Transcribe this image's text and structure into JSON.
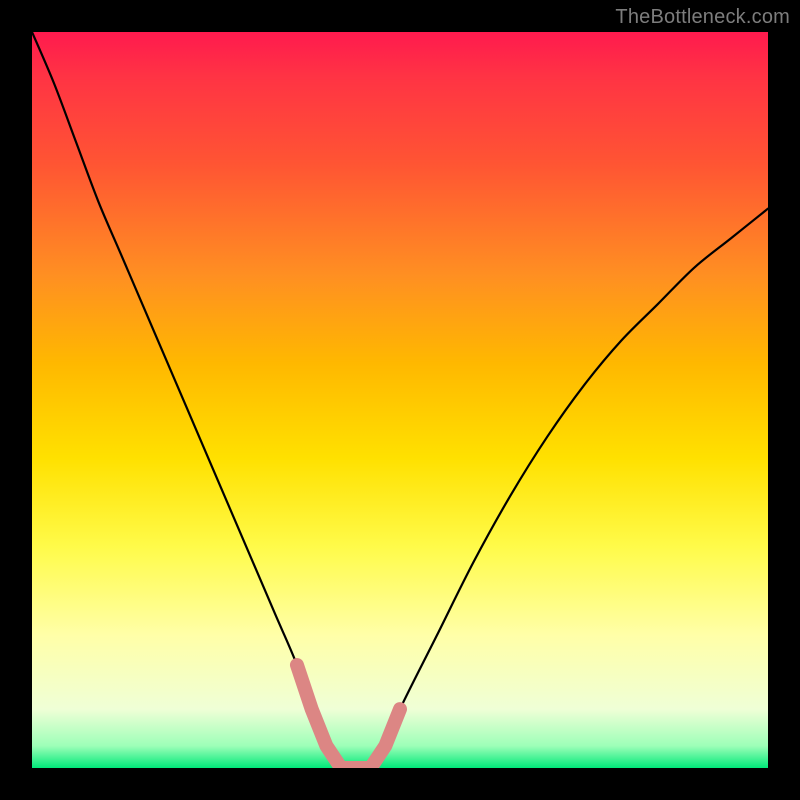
{
  "watermark": {
    "text": "TheBottleneck.com"
  },
  "colors": {
    "background": "#000000",
    "curve": "#000000",
    "marker": "#dc8684",
    "gradient_stops": [
      "#ff1a4e",
      "#ff3344",
      "#ff5533",
      "#ff8f22",
      "#ffb800",
      "#ffe100",
      "#fffb4a",
      "#ffffa8",
      "#efffd6",
      "#9dffb8",
      "#00e879"
    ]
  },
  "chart_data": {
    "type": "line",
    "title": "",
    "xlabel": "",
    "ylabel": "",
    "xlim": [
      0,
      100
    ],
    "ylim": [
      0,
      100
    ],
    "grid": false,
    "legend_position": "none",
    "series": [
      {
        "name": "bottleneck-curve",
        "x": [
          0,
          3,
          6,
          9,
          12,
          15,
          18,
          21,
          24,
          27,
          30,
          33,
          36,
          38,
          40,
          42,
          44,
          46,
          48,
          50,
          55,
          60,
          65,
          70,
          75,
          80,
          85,
          90,
          95,
          100
        ],
        "values": [
          100,
          93,
          85,
          77,
          70,
          63,
          56,
          49,
          42,
          35,
          28,
          21,
          14,
          8,
          3,
          0,
          0,
          0,
          3,
          8,
          18,
          28,
          37,
          45,
          52,
          58,
          63,
          68,
          72,
          76
        ]
      }
    ],
    "markers": {
      "name": "highlight-segment",
      "x": [
        36,
        38,
        40,
        42,
        44,
        46,
        48,
        50
      ],
      "values": [
        14,
        8,
        3,
        0,
        0,
        0,
        3,
        8
      ]
    },
    "annotations": []
  }
}
